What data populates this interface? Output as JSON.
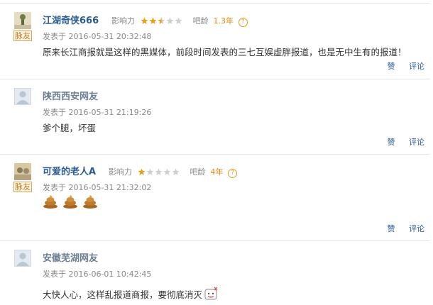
{
  "labels": {
    "influence": "影响力",
    "age": "吧龄",
    "posted_prefix": "发表于"
  },
  "actions": {
    "like": "赞",
    "reply": "评论"
  },
  "comments": [
    {
      "username": "江湖奇侠666",
      "badge": "脉友",
      "influence_stars": 2.5,
      "age": "1.3年",
      "time": "2016-05-31 20:32:48",
      "content": "原来长江商报就是这样的黑媒体，前段时间发表的三七互娱虚胖报道，也是无中生有的报道！"
    },
    {
      "username": "陕西西安网友",
      "time": "2016-05-31 21:19:26",
      "content": "爹个腿，坏蛋"
    },
    {
      "username": "可爱的老人A",
      "badge": "脉友",
      "influence_stars": 1,
      "age": "4年",
      "time": "2016-05-31 21:32:02",
      "content_emoji": "poop-emoji x3"
    },
    {
      "username": "安徽芜湖网友",
      "time": "2016-06-01 10:42:45",
      "content": "大快人心，这样乱报道商报，要彻底消灭"
    }
  ],
  "colors": {
    "username": "#2b5b94",
    "star_on": "#e8a21a",
    "star_off": "#cfcfcf",
    "age": "#e08a10"
  }
}
